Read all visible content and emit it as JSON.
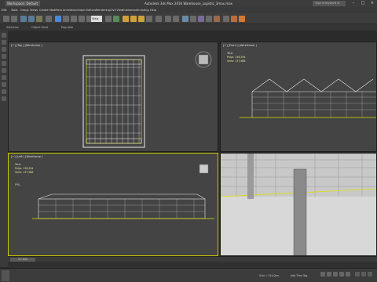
{
  "window": {
    "title": "Autodesk 3ds Max 2016    Warehouse_Logistic_3max.max",
    "workspace": "Workspace: Default",
    "search_placeholder": "Type a keyword or phrase"
  },
  "menu": [
    "Edit",
    "Tools",
    "Group",
    "Views",
    "Create",
    "Modifiers",
    "Animation",
    "Graph Editors",
    "Rendering",
    "Civil View",
    "Customize",
    "Scripting",
    "Help"
  ],
  "ribbon": [
    "Selection",
    "Object Paint",
    "Populate"
  ],
  "toolbar": {
    "view_dropdown": "View"
  },
  "viewports": {
    "top": {
      "label": "[+] [Top ] [Wireframe ]"
    },
    "front": {
      "label": "[+] [Front ] [Wireframe ]",
      "stats": {
        "title": "Total",
        "polys_label": "Polys:",
        "polys": "136,294",
        "verts_label": "Verts:",
        "verts": "137,988"
      }
    },
    "left": {
      "label": "[+] [Left ] [Wireframe ]",
      "stats": {
        "title": "Total",
        "polys_label": "Polys:",
        "polys": "136,294",
        "verts_label": "Verts:",
        "verts": "137,988"
      },
      "fps": "FPS:"
    },
    "persp": {
      "label": ""
    }
  },
  "timeline": {
    "frame": "0 / 100"
  },
  "status": {
    "coords": "Grid = 254,0cm",
    "addtime": "Add Time Tag"
  },
  "colors": {
    "viewport_bg": "#444444",
    "active_border": "#c8c800",
    "wire": "#e8e8e8",
    "highlight": "#e0e000"
  }
}
